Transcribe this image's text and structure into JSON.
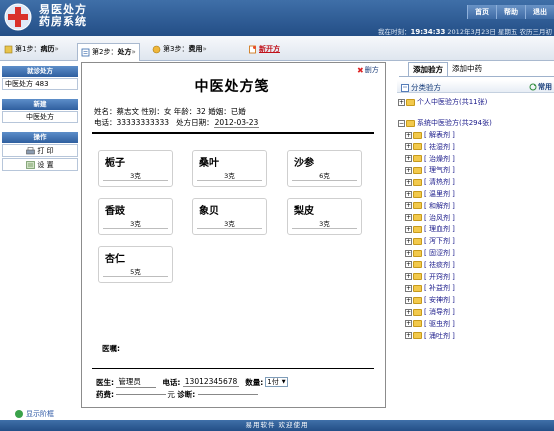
{
  "app": {
    "title_line1": "易医处方",
    "title_line2": "药房系统"
  },
  "top_nav": [
    "首页",
    "帮助",
    "退出"
  ],
  "status": {
    "prefix": "我在时刻：",
    "time": "19:34:33",
    "date": "2012年3月23日 星期五 农历三月初"
  },
  "steps": [
    {
      "label": "第1步：",
      "value": "病历",
      "arrow": "»"
    },
    {
      "label": "第2步：",
      "value": "处方",
      "arrow": "»"
    },
    {
      "label": "第3步：",
      "value": "费用",
      "arrow": "»"
    },
    {
      "label": "",
      "value": "新开方",
      "arrow": ""
    }
  ],
  "sidebar": {
    "rx_header": "就诊处方",
    "rx_item": "中医处方 483",
    "new_header": "新建",
    "new_item": "中医处方",
    "ops_header": "操作",
    "print": "打 印",
    "settings": "设 置"
  },
  "show_frame": "显示阶框",
  "rx": {
    "close": "删方",
    "title": "中医处方笺",
    "patient": "姓名：蔡志文   性别：女   年龄：32   婚姻：已婚",
    "phone_label": "电话：",
    "phone": "33333333333",
    "date_label": "处方日期：",
    "date": "2012-03-23",
    "herbs": [
      {
        "name": "栀子",
        "dose": "3克"
      },
      {
        "name": "桑叶",
        "dose": "3克"
      },
      {
        "name": "沙参",
        "dose": "6克"
      },
      {
        "name": "香豉",
        "dose": "3克"
      },
      {
        "name": "象贝",
        "dose": "3克"
      },
      {
        "name": "梨皮",
        "dose": "3克"
      },
      {
        "name": "杏仁",
        "dose": "5克"
      }
    ],
    "advice_label": "医嘱:",
    "doctor_label": "医生:",
    "doctor": "管理员",
    "tel_label": "电话:",
    "tel": "13012345678",
    "qty_label": "数量:",
    "qty": "1付",
    "fee_label": "药费:",
    "fee_unit": "元",
    "diag_label": "诊断:"
  },
  "right": {
    "tabs": [
      "添加验方",
      "添加中药"
    ],
    "cat_title": "分类验方",
    "common": "常用",
    "personal": "个人中医验方(共11张)",
    "system": "系统中医验方(共294张)",
    "categories": [
      "解表剂",
      "祛湿剂",
      "治燥剂",
      "理气剂",
      "清热剂",
      "温里剂",
      "和解剂",
      "治风剂",
      "理血剂",
      "泻下剂",
      "固涩剂",
      "祛痰剂",
      "开窍剂",
      "补益剂",
      "安神剂",
      "消导剂",
      "驱虫剂",
      "涌吐剂"
    ]
  },
  "footer": "易用软件 欢迎使用"
}
